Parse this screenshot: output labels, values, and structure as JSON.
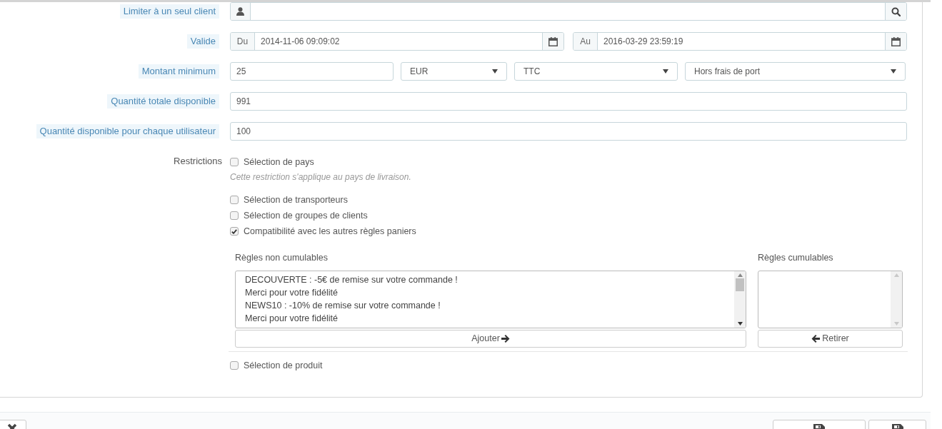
{
  "client_filter": {
    "label": "Limiter à un seul client"
  },
  "validity": {
    "label": "Valide",
    "from": {
      "prefix": "Du",
      "value": "2014-11-06 09:09:02"
    },
    "to": {
      "prefix": "Au",
      "value": "2016-03-29 23:59:19"
    }
  },
  "minimum_amount": {
    "label": "Montant minimum",
    "value": "25",
    "selects": [
      "EUR",
      "TTC",
      "Hors frais de port"
    ]
  },
  "quantities": [
    {
      "label": "Quantité totale disponible",
      "value": "991"
    },
    {
      "label": "Quantité disponible pour chaque utilisateur",
      "value": "100"
    }
  ],
  "restrictions": {
    "label": "Restrictions",
    "options": [
      {
        "label": "Sélection de pays",
        "checked": false,
        "hint": "Cette restriction s'applique au pays de livraison."
      },
      {
        "label": "Sélection de transporteurs",
        "checked": false
      },
      {
        "label": "Sélection de groupes de clients",
        "checked": false
      },
      {
        "label": "Compatibilité avec les autres règles paniers",
        "checked": true
      }
    ]
  },
  "rules": {
    "non_cumulative": {
      "label": "Règles non cumulables",
      "items": [
        "DECOUVERTE : -5€ de remise sur votre commande !",
        "Merci pour votre fidélité",
        "NEWS10 : -10% de remise sur votre commande !",
        "Merci pour votre fidélité"
      ]
    },
    "add_button": "Ajouter",
    "cumulative": {
      "label": "Règles cumulables"
    },
    "remove_button": "Retirer"
  },
  "product_selection": {
    "label": "Sélection de produit",
    "checked": false
  }
}
